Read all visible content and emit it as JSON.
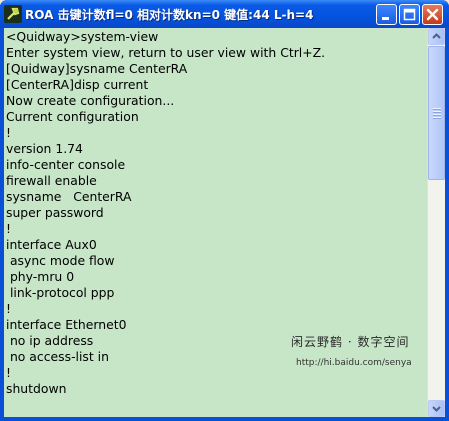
{
  "window": {
    "title": "ROA 击键计数fl=0 相对计数kn=0 键值:44 L-h=4"
  },
  "terminal": {
    "lines": [
      "<Quidway>system-view",
      "Enter system view, return to user view with Ctrl+Z.",
      "[Quidway]sysname CenterRA",
      "[CenterRA]disp current",
      "Now create configuration...",
      "Current configuration",
      "!",
      "version 1.74",
      "info-center console",
      "firewall enable",
      "sysname   CenterRA",
      "super password",
      "!",
      "interface Aux0",
      " async mode flow",
      " phy-mru 0",
      " link-protocol ppp",
      "!",
      "interface Ethernet0",
      " no ip address",
      " no access-list in",
      "!",
      "shutdown"
    ]
  },
  "watermark": {
    "signature": "闲云野鹤 · 数字空间",
    "url": "http://hi.baidu.com/senya"
  },
  "icons": {
    "app": "wrench-app-icon",
    "minimize": "minimize-icon",
    "maximize": "maximize-icon",
    "close": "close-icon",
    "scroll_up": "scroll-up-arrow-icon",
    "scroll_down": "scroll-down-arrow-icon"
  },
  "colors": {
    "terminal_background": "#c7e5c7",
    "title_bar": "#0453df",
    "close_button": "#c43a1b"
  }
}
